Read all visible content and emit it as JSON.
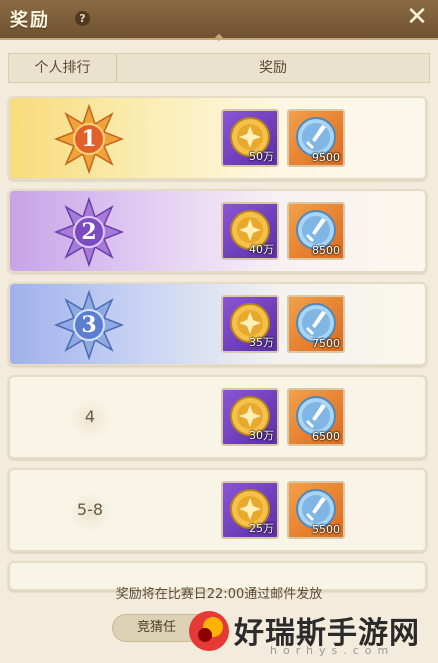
{
  "header": {
    "title": "奖励",
    "help_glyph": "?",
    "close_glyph": "✕"
  },
  "columns": {
    "rank": "个人排行",
    "reward": "奖励"
  },
  "rows": [
    {
      "rank": "1",
      "tier": "gold",
      "coin": "50万",
      "sword": "9500"
    },
    {
      "rank": "2",
      "tier": "purple",
      "coin": "40万",
      "sword": "8500"
    },
    {
      "rank": "3",
      "tier": "blue",
      "coin": "35万",
      "sword": "7500"
    },
    {
      "rank": "4",
      "tier": "plain",
      "coin": "30万",
      "sword": "6500"
    },
    {
      "rank": "5-8",
      "tier": "plain",
      "coin": "25万",
      "sword": "5500"
    }
  ],
  "footer": {
    "note": "奖励将在比赛日22:00通过邮件发放",
    "guess_button": "竞猜任"
  },
  "watermark": {
    "text": "好瑞斯手游网",
    "sub": "horhys.com"
  },
  "colors": {
    "header_bg": "#7b5e3b",
    "gold_medal": "#e8862a",
    "purple_medal": "#8a5cc9",
    "blue_medal": "#5a7fcf",
    "coin_bg": "#7440c0",
    "sword_bg": "#e8832e"
  }
}
